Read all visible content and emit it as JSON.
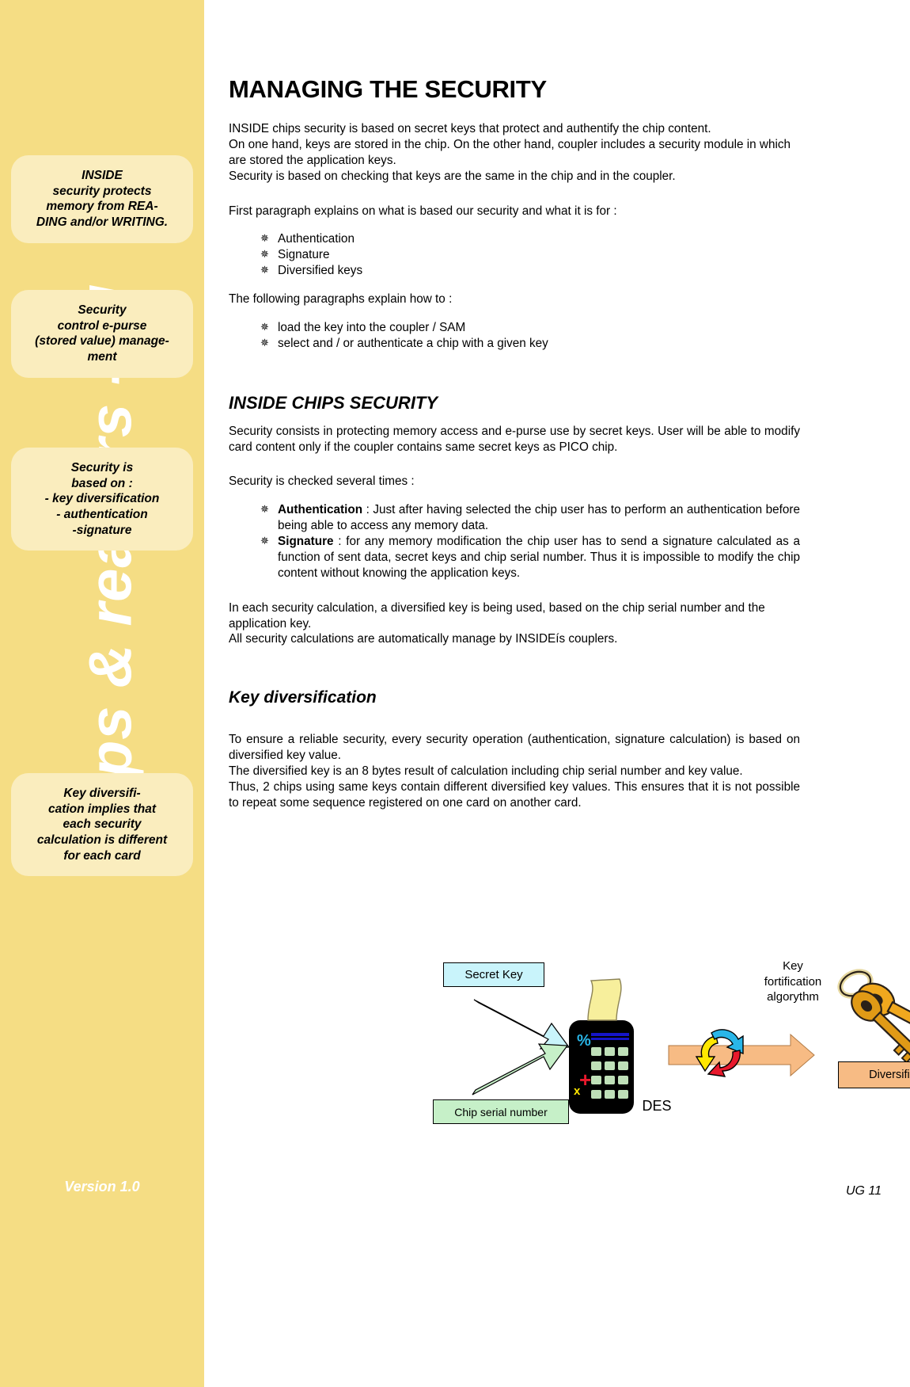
{
  "sidebar": {
    "brand_vertical_text": "Chips & readers - RI",
    "version_label": "Version 1.0",
    "callouts": [
      "INSIDE\nsecurity protects\nmemory from REA-\nDING and/or WRITING.",
      "Security\ncontrol e-purse\n(stored value) manage-\nment",
      "Security is\nbased on :\n- key diversification\n- authentication\n-signature",
      "Key diversifi-\ncation implies that\neach security\ncalculation is different\nfor each card"
    ]
  },
  "document": {
    "title": "MANAGING THE SECURITY",
    "intro": "INSIDE chips security is based on secret keys that protect and authentify the chip content.\nOn one hand, keys are stored in the chip. On the other hand, coupler includes a security module in which are stored the application keys.\nSecurity is based on checking that keys are the same in the chip and in the coupler.",
    "first_paragraph_lead": "First paragraph explains on what is based our security and what it is for :",
    "first_list": [
      "Authentication",
      "Signature",
      "Diversified keys"
    ],
    "following_lead": "The following paragraphs explain how to :",
    "following_list": [
      "load the key into the coupler / SAM",
      "select and / or authenticate a chip with a given key"
    ],
    "section1": {
      "heading": "INSIDE CHIPS SECURITY",
      "para1": "Security consists in protecting memory access and e-purse use by secret keys. User will be able to modify card content only if the coupler contains same secret keys as PICO chip.",
      "para2": "Security is checked several times :",
      "checks": [
        {
          "term": "Authentication",
          "text": " : Just after having selected the chip user has to perform an authentication before being able to access any memory data."
        },
        {
          "term": "Signature",
          "text": " : for any memory modification the chip user has to send a signature calculated as a function of sent data, secret keys and chip serial number. Thus it is impossible to modify the chip content without knowing the application keys."
        }
      ],
      "para3": "In each security calculation, a diversified key is being used, based on the chip serial number and  the application key.\nAll security calculations are automatically manage by INSIDEís couplers."
    },
    "section2": {
      "heading": "Key diversification",
      "para1": "To ensure a reliable security, every security operation (authentication, signature calculation) is based on diversified key value.",
      "para2": "The diversified key is an 8 bytes result of calculation including chip serial number and key value.",
      "para3": "Thus, 2 chips using same keys contain different diversified key values. This ensures that it is not possible to repeat some sequence registered on one card on another card."
    }
  },
  "diagram": {
    "secret_key_label": "Secret Key",
    "chip_serial_label": "Chip serial number",
    "des_label": "DES",
    "key_fortification_label": "Key\nfortification\nalgorythm",
    "diversified_key_label": "Diversified Key",
    "colors": {
      "secret_key_fill": "#c9f4fb",
      "chip_serial_fill": "#c6f0c8",
      "diversified_key_fill": "#f7bb84",
      "calculator_body": "#000000",
      "paper_slip": "#f7ef9c",
      "cycle_blue": "#29b6e8",
      "cycle_yellow": "#ffe700",
      "cycle_red": "#e8192c",
      "key_gold": "#f0a81e"
    }
  },
  "footer": {
    "page_label": "UG 11"
  },
  "theme": {
    "sidebar_bg": "#f5dd84",
    "callout_bg": "#faedbe",
    "text": "#000000"
  }
}
